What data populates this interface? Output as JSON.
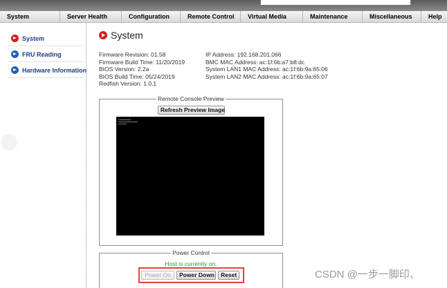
{
  "nav": {
    "items": [
      {
        "label": "System",
        "width": 87
      },
      {
        "label": "Server Health",
        "width": 89
      },
      {
        "label": "Configuration",
        "width": 85
      },
      {
        "label": "Remote Control",
        "width": 87
      },
      {
        "label": "Virtual Media",
        "width": 90
      },
      {
        "label": "Maintenance",
        "width": 86
      },
      {
        "label": "Miscellaneous",
        "width": 85
      },
      {
        "label": "Help",
        "width": 37
      }
    ]
  },
  "sidebar": {
    "items": [
      {
        "label": "System",
        "icon": "red-arrow-circle-icon"
      },
      {
        "label": "FRU Reading",
        "icon": "blue-arrow-circle-icon"
      },
      {
        "label": "Hardware Information",
        "icon": "blue-arrow-circle-icon"
      }
    ]
  },
  "page": {
    "title": "System"
  },
  "info": {
    "left": [
      "Firmware Revision: 01.58",
      "Firmware Build Time: 11/20/2019",
      "BIOS Version: 2.2a",
      "BIOS Build Time: 05/24/2019",
      "Redfish Version: 1.0.1"
    ],
    "right": [
      "IP Address: 192.168.201.066",
      "BMC MAC Address: ac:1f:6b:a7:b8:dc",
      "System LAN1 MAC Address: ac:1f:6b:9a:65:06",
      "System LAN2 MAC Address: ac:1f:6b:9a:65:07"
    ]
  },
  "remote_console": {
    "legend": "Remote Console Preview",
    "refresh_label": "Refresh Preview Image"
  },
  "power_control": {
    "legend": "Power Control",
    "status": "Host is currently on.",
    "power_on_label": "Power On",
    "power_down_label": "Power Down",
    "reset_label": "Reset"
  },
  "watermark": "CSDN @一步一脚印、",
  "colors": {
    "accent_red": "#d51e1e",
    "link_blue": "#1a3f8a",
    "status_green": "#2e9a2e",
    "highlight_red": "#e0433a"
  }
}
